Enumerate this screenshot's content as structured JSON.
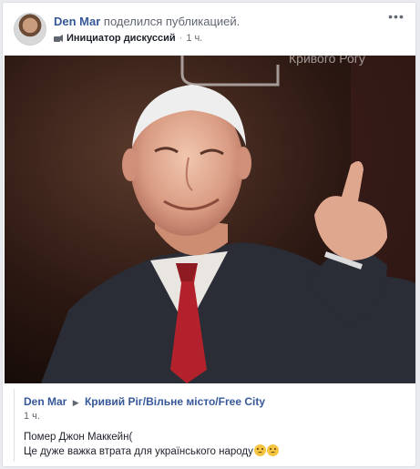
{
  "post": {
    "author": "Den Mar",
    "action": "поделился публикацией.",
    "badge": "Инициатор дискуссий",
    "time": "1 ч.",
    "menu_icon": "more-dots-icon"
  },
  "watermark": {
    "text": "Кривого Рогу"
  },
  "shared": {
    "author": "Den Mar",
    "target": "Кривий Ріг/Вільне місто/Free City",
    "time": "1 ч.",
    "line1": "Помер Джон Маккейн(",
    "line2": "Це дуже важка втрата для українського народу"
  },
  "colors": {
    "link": "#365899",
    "muted": "#616770",
    "background": "#e9ebee"
  }
}
